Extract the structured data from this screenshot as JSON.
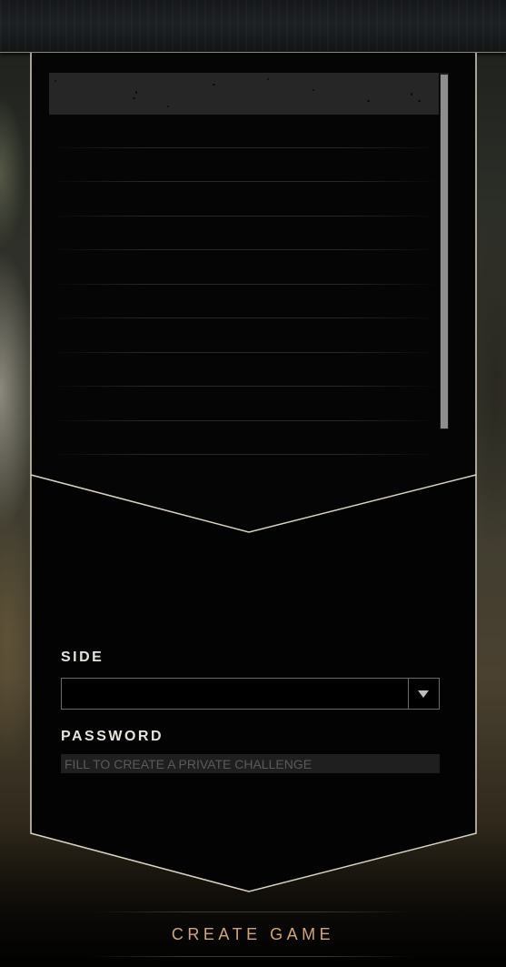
{
  "form": {
    "side_label": "SIDE",
    "side_value": "",
    "password_label": "PASSWORD",
    "password_value": "",
    "password_placeholder": "FILL TO CREATE A PRIVATE CHALLENGE"
  },
  "actions": {
    "create_game_label": "CREATE GAME"
  },
  "game_list": {
    "row_count": 10,
    "rows": [
      "",
      "",
      "",
      "",
      "",
      "",
      "",
      "",
      "",
      ""
    ]
  },
  "colors": {
    "accent": "#d0a57c",
    "panel_border": "#d9d3c3",
    "panel_bg": "#000000",
    "label_text": "#e6e3dc",
    "scrollbar_thumb": "#8e8e8e",
    "input_bg": "#1f1f1f"
  },
  "icons": {
    "dropdown": "chevron-down-icon"
  }
}
